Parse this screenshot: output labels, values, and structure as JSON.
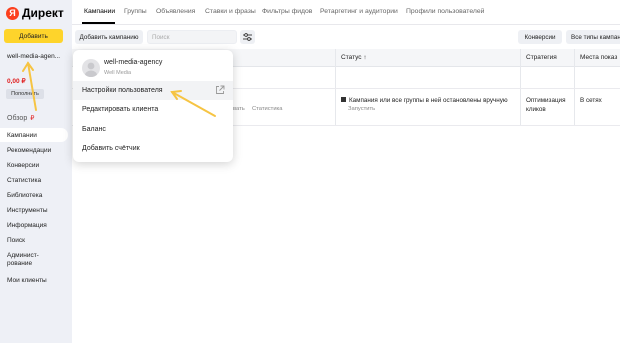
{
  "app": {
    "logo_letter": "Я",
    "logo_text": "Директ",
    "add_button": "Добавить",
    "account_name": "well-media-agen...",
    "balance": "0,00 ₽",
    "topup_button": "Пополнить",
    "overview": {
      "label": "Обзор",
      "badge": "₽"
    }
  },
  "sidebar": {
    "items": [
      {
        "label": "Кампании"
      },
      {
        "label": "Рекомендации"
      },
      {
        "label": "Конверсии"
      },
      {
        "label": "Статистика"
      },
      {
        "label": "Библиотека"
      },
      {
        "label": "Инструменты"
      },
      {
        "label": "Информация"
      },
      {
        "label": "Поиск"
      },
      {
        "label_line1": "Админист-",
        "label_line2": "рование"
      },
      {
        "label": "Мои клиенты"
      }
    ]
  },
  "tabs": [
    {
      "label": "Кампании"
    },
    {
      "label": "Группы"
    },
    {
      "label": "Объявления"
    },
    {
      "label": "Ставки и фразы"
    },
    {
      "label": "Фильтры фидов"
    },
    {
      "label": "Ретаргетинг и аудитории"
    },
    {
      "label": "Профили пользователей"
    }
  ],
  "toolbar": {
    "add_campaign": "Добавить кампанию",
    "search_placeholder": "Поиск",
    "conversions": "Конверсии",
    "all_types": "Все типы кампан"
  },
  "table": {
    "headers": {
      "status": "Статус",
      "strategy": "Стратегия",
      "placements": "Места показ"
    },
    "row": {
      "links_partial": "вать",
      "stats_link": "Статистика",
      "status_text": "Кампания или все группы в ней остановлены вручную",
      "status_action": "Запустить",
      "strategy_line1": "Оптимизация",
      "strategy_line2": "кликов",
      "placement": "В сетях"
    }
  },
  "dropdown": {
    "name": "well-media-agency",
    "subtitle": "Well Media",
    "items": [
      {
        "label": "Настройки пользователя"
      },
      {
        "label": "Редактировать клиента"
      },
      {
        "label": "Баланс"
      },
      {
        "label": "Добавить счётчик"
      }
    ]
  },
  "colors": {
    "accent_yellow": "#fed42b",
    "brand_red": "#fc3f1d",
    "annotation_arrow": "#f6c443",
    "sidebar_bg": "#eef0f6"
  }
}
